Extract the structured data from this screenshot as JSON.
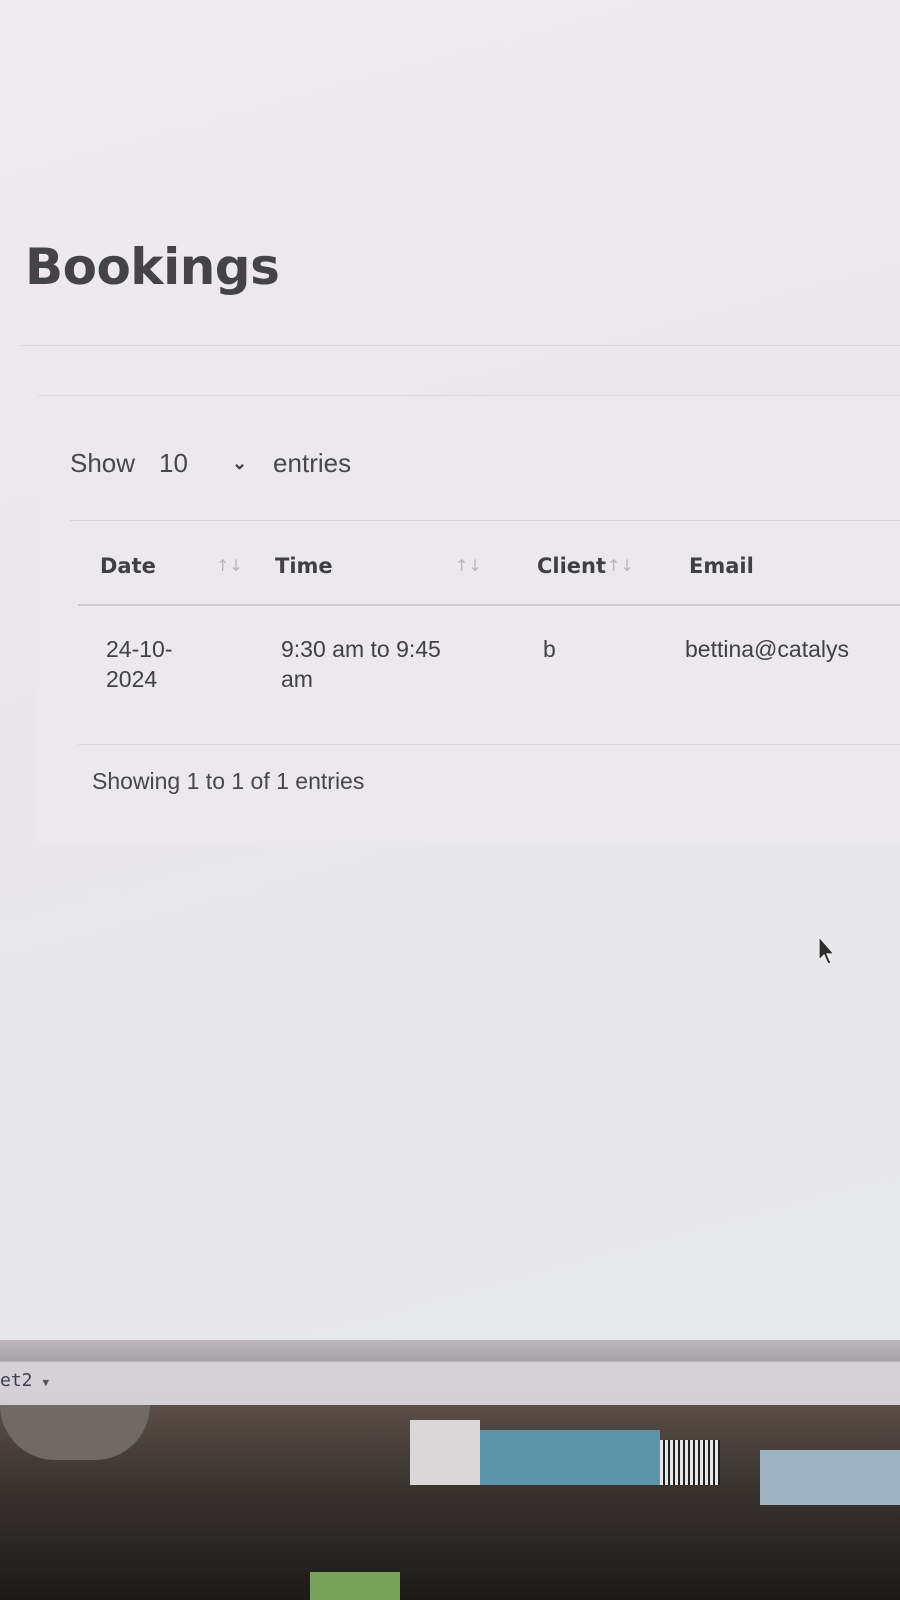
{
  "page": {
    "title": "Bookings"
  },
  "length_control": {
    "prefix": "Show",
    "selected": "10",
    "suffix": "entries"
  },
  "table": {
    "columns": [
      "Date",
      "Time",
      "Client",
      "Email"
    ],
    "rows": [
      {
        "date": "24-10-2024",
        "time": "9:30 am to 9:45 am",
        "client": "b",
        "email": "bettina@catalys"
      }
    ]
  },
  "info": {
    "text": "Showing 1 to 1 of 1 entries"
  },
  "taskbar": {
    "label": "et2"
  },
  "colors": {
    "sidebar": "#3d5a5c",
    "title_text": "#434348",
    "sort_icon": "#b7b4bb"
  }
}
